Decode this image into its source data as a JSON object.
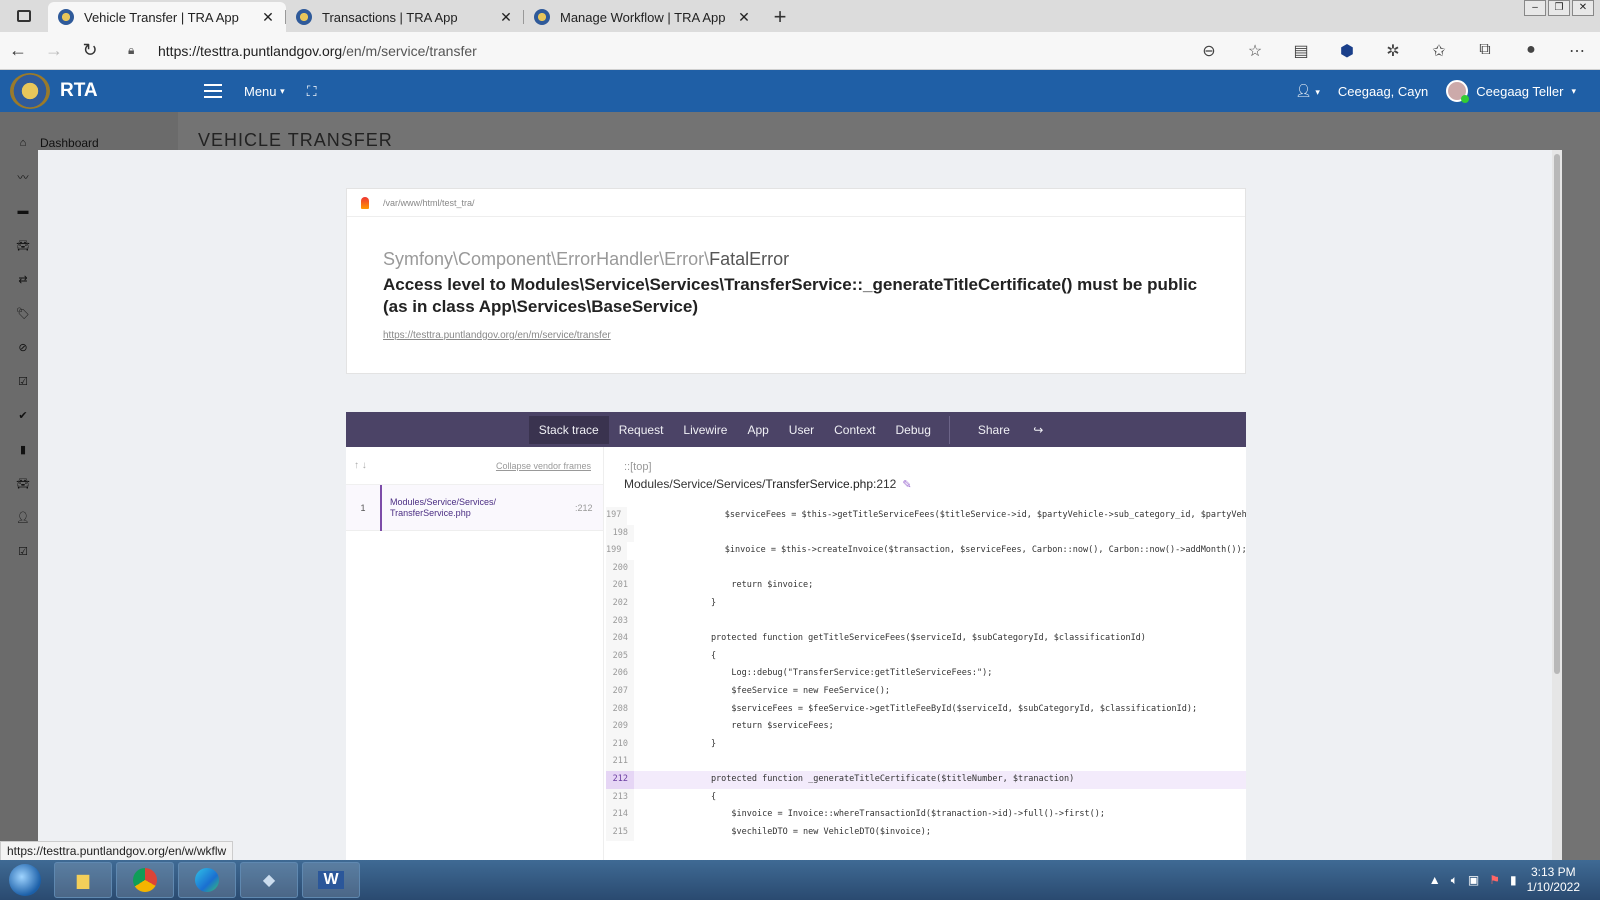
{
  "browser": {
    "tabs": [
      {
        "title": "Vehicle Transfer | TRA App",
        "active": true
      },
      {
        "title": "Transactions | TRA App",
        "active": false
      },
      {
        "title": "Manage Workflow | TRA App",
        "active": false
      }
    ],
    "url_host": "https://testtra.puntlandgov.org",
    "url_path": "/en/m/service/transfer",
    "status_url": "https://testtra.puntlandgov.org/en/w/wkflw"
  },
  "app": {
    "brand": "RTA",
    "menu_label": "Menu",
    "user_location": "Ceegaag, Cayn",
    "user_name": "Ceegaag Teller",
    "page_title": "VEHICLE TRANSFER",
    "sidebar_first": "Dashboard"
  },
  "error": {
    "path": "/var/www/html/test_tra/",
    "class_prefix": "Symfony\\Component\\ErrorHandler\\Error\\",
    "class_name": "FatalError",
    "message": "Access level to Modules\\Service\\Services\\TransferService::_generateTitleCertificate() must be public (as in class App\\Services\\BaseService)",
    "url": "https://testtra.puntlandgov.org/en/m/service/transfer"
  },
  "trace": {
    "tabs": [
      "Stack trace",
      "Request",
      "Livewire",
      "App",
      "User",
      "Context",
      "Debug"
    ],
    "share": "Share",
    "collapse_label": "Collapse vendor frames",
    "frame": {
      "num": "1",
      "file": "Modules/Service/Services/ TransferService.php",
      "line": ":212"
    },
    "top_label": "::[top]",
    "file_path": "Modules/Service/Services/",
    "file_name": "TransferService.php",
    "file_line": ":212",
    "lines": [
      {
        "n": "197",
        "t": "            $serviceFees = $this->getTitleServiceFees($titleService->id, $partyVehicle->sub_category_id, $partyVehicle->cla"
      },
      {
        "n": "198",
        "t": ""
      },
      {
        "n": "199",
        "t": "            $invoice = $this->createInvoice($transaction, $serviceFees, Carbon::now(), Carbon::now()->addMonth());"
      },
      {
        "n": "200",
        "t": ""
      },
      {
        "n": "201",
        "t": "            return $invoice;"
      },
      {
        "n": "202",
        "t": "        }"
      },
      {
        "n": "203",
        "t": ""
      },
      {
        "n": "204",
        "t": "        protected function getTitleServiceFees($serviceId, $subCategoryId, $classificationId)"
      },
      {
        "n": "205",
        "t": "        {"
      },
      {
        "n": "206",
        "t": "            Log::debug(\"TransferService:getTitleServiceFees:\");"
      },
      {
        "n": "207",
        "t": "            $feeService = new FeeService();"
      },
      {
        "n": "208",
        "t": "            $serviceFees = $feeService->getTitleFeeById($serviceId, $subCategoryId, $classificationId);"
      },
      {
        "n": "209",
        "t": "            return $serviceFees;"
      },
      {
        "n": "210",
        "t": "        }"
      },
      {
        "n": "211",
        "t": ""
      },
      {
        "n": "212",
        "t": "        protected function _generateTitleCertificate($titleNumber, $tranaction)",
        "highlight": true
      },
      {
        "n": "213",
        "t": "        {"
      },
      {
        "n": "214",
        "t": "            $invoice = Invoice::whereTransactionId($tranaction->id)->full()->first();"
      },
      {
        "n": "215",
        "t": "            $vechileDTO = new VehicleDTO($invoice);"
      }
    ]
  },
  "taskbar": {
    "time": "3:13 PM",
    "date": "1/10/2022"
  }
}
